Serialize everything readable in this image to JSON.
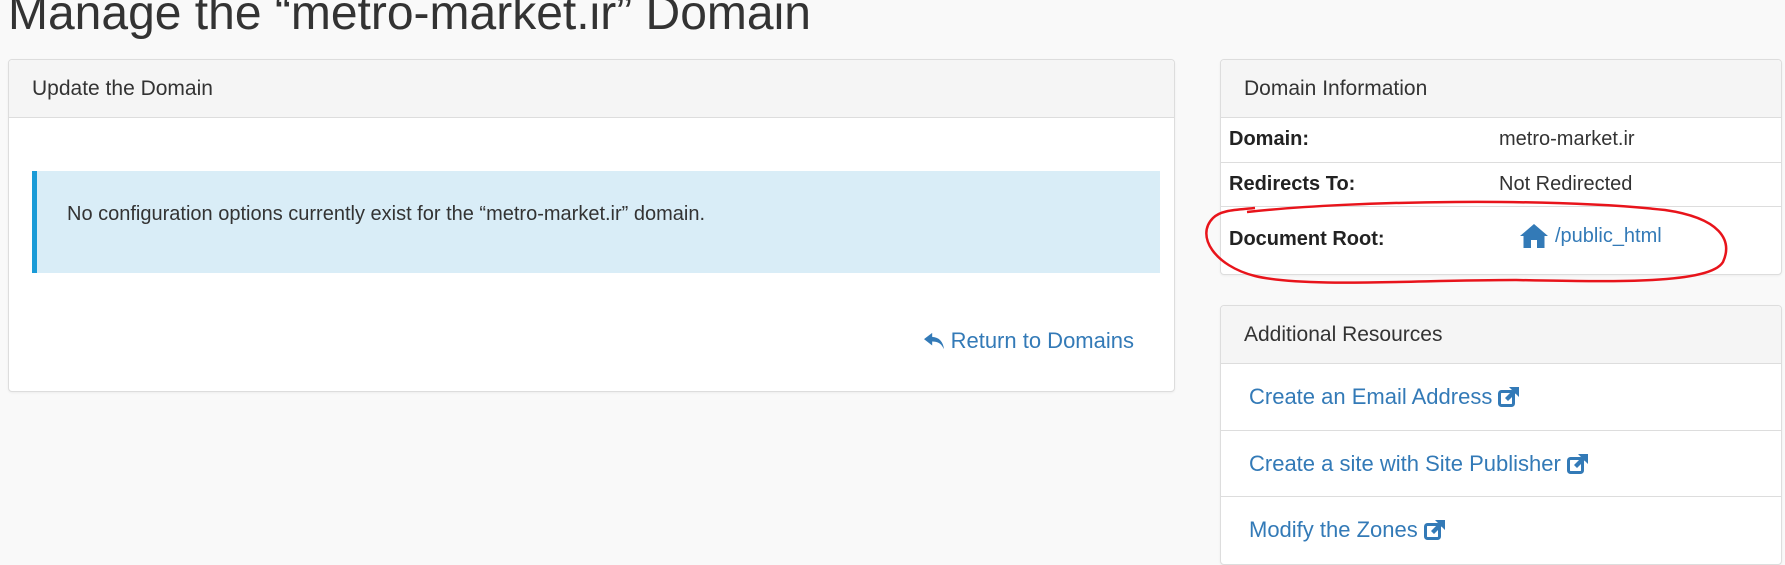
{
  "page": {
    "title": "Manage the “metro-market.ir” Domain"
  },
  "update_panel": {
    "heading": "Update the Domain",
    "alert_text": "No configuration options currently exist for the “metro-market.ir” domain.",
    "return_label": "Return to Domains"
  },
  "info_panel": {
    "heading": "Domain Information",
    "rows": [
      {
        "label": "Domain:",
        "value": "metro-market.ir"
      },
      {
        "label": "Redirects To:",
        "value": "Not Redirected"
      },
      {
        "label": "Document Root:",
        "value": "/public_html"
      }
    ]
  },
  "resources_panel": {
    "heading": "Additional Resources",
    "links": [
      {
        "label": "Create an Email Address"
      },
      {
        "label": "Create a site with Site Publisher"
      },
      {
        "label": "Modify the Zones"
      }
    ]
  },
  "colors": {
    "link": "#337ab7",
    "alert_bg": "#d9edf7",
    "alert_border": "#1a9bd7",
    "annotation": "#e8141b"
  },
  "icons": {
    "return": "reply-arrow-icon",
    "document_root": "home-icon",
    "external": "external-link-icon"
  }
}
